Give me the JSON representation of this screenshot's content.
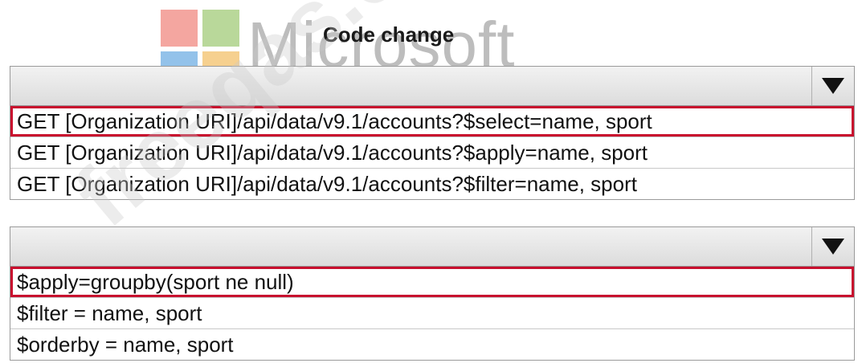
{
  "header": {
    "title": "Code change",
    "logo_text": "Microsoft",
    "logo_colors": [
      "#f25022",
      "#7fba00",
      "#00a4ef",
      "#ffb900"
    ]
  },
  "dropdowns": [
    {
      "selected_index": 0,
      "options": [
        "GET [Organization URI]/api/data/v9.1/accounts?$select=name, sport",
        "GET [Organization URI]/api/data/v9.1/accounts?$apply=name, sport",
        "GET [Organization URI]/api/data/v9.1/accounts?$filter=name, sport"
      ]
    },
    {
      "selected_index": 0,
      "options": [
        "$apply=groupby(sport ne null)",
        "$filter = name, sport",
        "$orderby = name, sport"
      ]
    }
  ],
  "colors": {
    "selection_outline": "#c8102e"
  },
  "watermark": {
    "text": "freeqas.com"
  }
}
